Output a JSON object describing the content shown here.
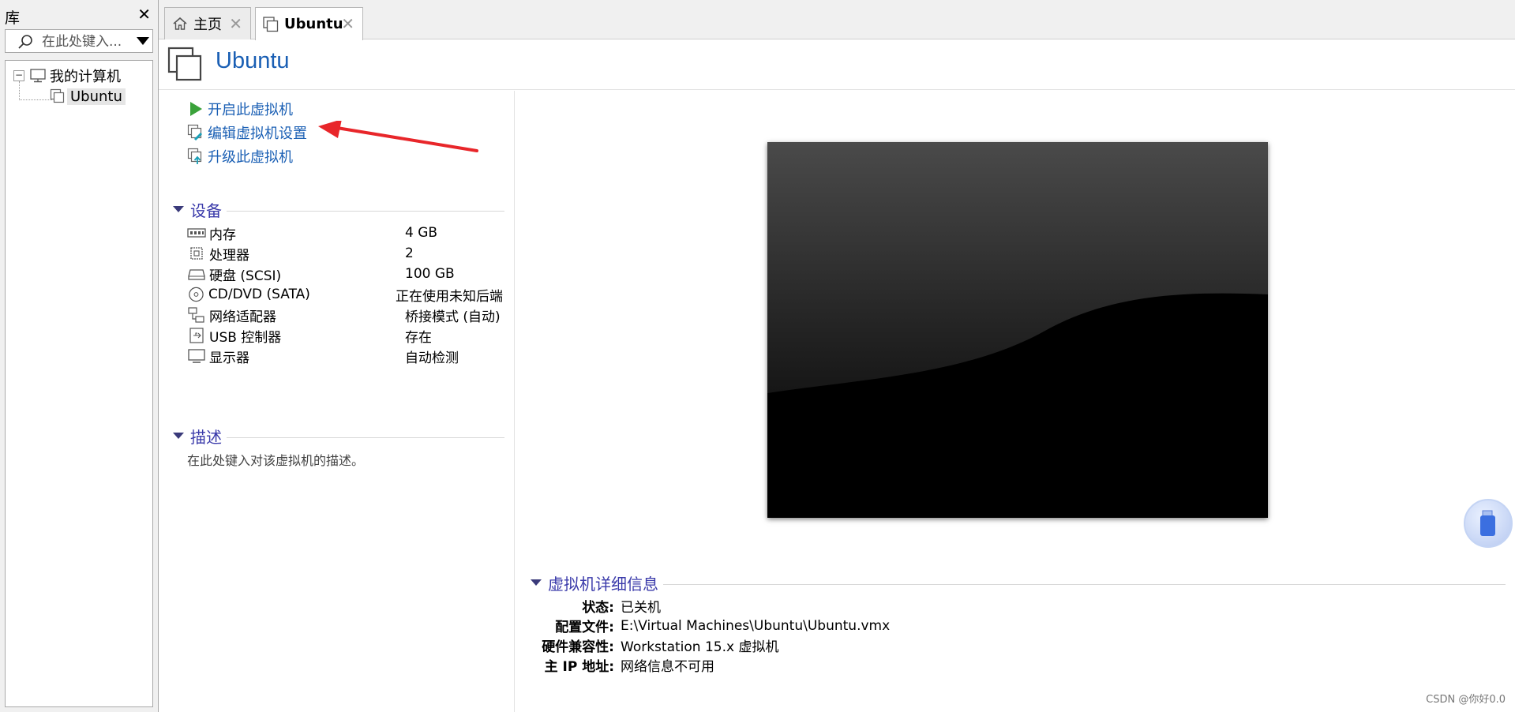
{
  "library": {
    "title": "库",
    "close_glyph": "✕",
    "search_placeholder": "在此处键入...",
    "tree": {
      "root_label": "我的计算机",
      "collapse_glyph": "−",
      "vm_label": "Ubuntu"
    }
  },
  "tabs": [
    {
      "label": "主页",
      "icon": "home-icon",
      "close_glyph": "✕"
    },
    {
      "label": "Ubuntu",
      "icon": "vm-icon",
      "close_glyph": "✕"
    }
  ],
  "vm": {
    "title": "Ubuntu",
    "actions": [
      {
        "label": "开启此虚拟机",
        "icon": "play-icon"
      },
      {
        "label": "编辑虚拟机设置",
        "icon": "edit-settings-icon"
      },
      {
        "label": "升级此虚拟机",
        "icon": "upgrade-icon"
      }
    ],
    "devices_title": "设备",
    "devices": [
      {
        "name": "内存",
        "value": "4 GB",
        "icon": "memory-icon"
      },
      {
        "name": "处理器",
        "value": "2",
        "icon": "processor-icon"
      },
      {
        "name": "硬盘 (SCSI)",
        "value": "100 GB",
        "icon": "hard-disk-icon"
      },
      {
        "name": "CD/DVD (SATA)",
        "value": "正在使用未知后端",
        "icon": "cd-dvd-icon"
      },
      {
        "name": "网络适配器",
        "value": "桥接模式 (自动)",
        "icon": "network-adapter-icon"
      },
      {
        "name": "USB 控制器",
        "value": "存在",
        "icon": "usb-controller-icon"
      },
      {
        "name": "显示器",
        "value": "自动检测",
        "icon": "display-icon"
      }
    ],
    "description_title": "描述",
    "description_placeholder": "在此处键入对该虚拟机的描述。",
    "details_title": "虚拟机详细信息",
    "details": [
      {
        "key": "状态:",
        "value": "已关机"
      },
      {
        "key": "配置文件:",
        "value": "E:\\Virtual Machines\\Ubuntu\\Ubuntu.vmx"
      },
      {
        "key": "硬件兼容性:",
        "value": "Workstation 15.x 虚拟机"
      },
      {
        "key": "主 IP 地址:",
        "value": "网络信息不可用"
      }
    ]
  },
  "watermark": "CSDN @你好0.0",
  "colors": {
    "link_blue": "#1a5fb4",
    "section_blue": "#3a3aaa",
    "annotation_red": "#e8262a",
    "play_green": "#3aa23a"
  }
}
